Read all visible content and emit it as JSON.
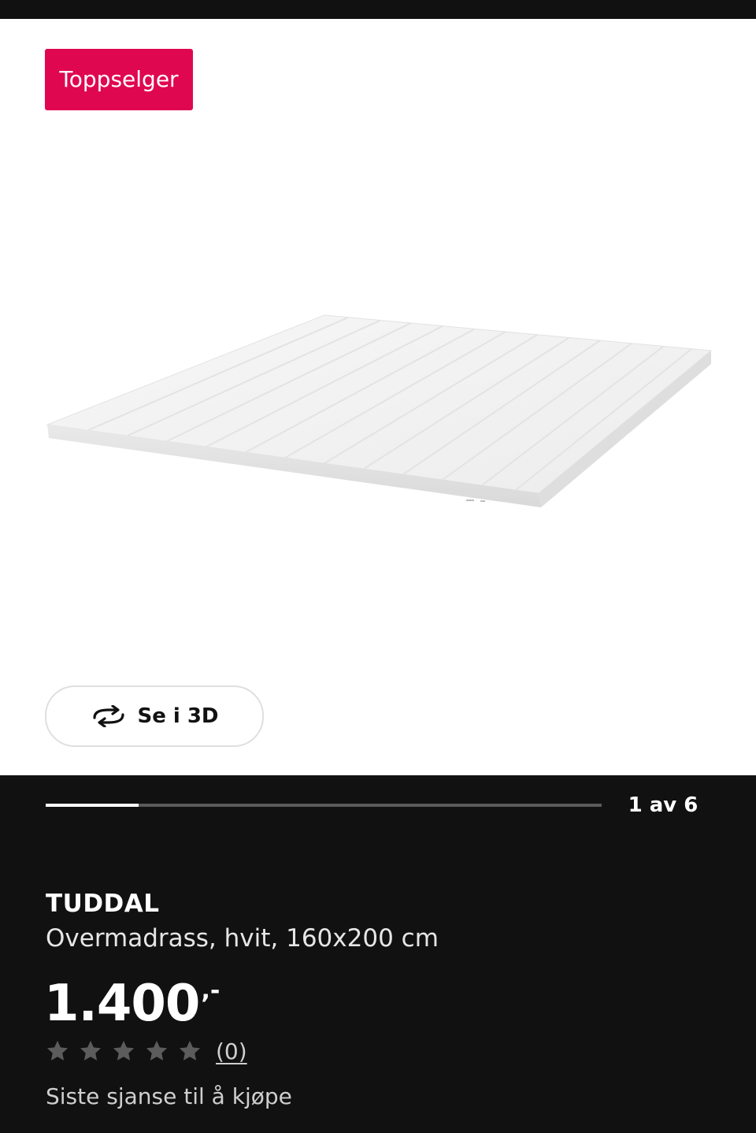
{
  "product": {
    "badge": "Toppselger",
    "view_3d_label": "Se i 3D",
    "gallery": {
      "current_index": 1,
      "total": 6,
      "counter_label": "1 av 6"
    },
    "name": "TUDDAL",
    "description": "Overmadrass, hvit, 160x200 cm",
    "price": "1.400",
    "price_suffix": ",-",
    "rating": {
      "stars": 0,
      "max_stars": 5,
      "review_count_label": "(0)"
    },
    "availability": "Siste sjanse til å kjøpe"
  },
  "colors": {
    "badge_bg": "#e00751",
    "page_bg": "#111111",
    "gallery_bg": "#ffffff",
    "star_empty": "#5c5c5c"
  },
  "icons": {
    "view_3d": "rotate-3d-icon",
    "rating_star": "star-icon"
  }
}
